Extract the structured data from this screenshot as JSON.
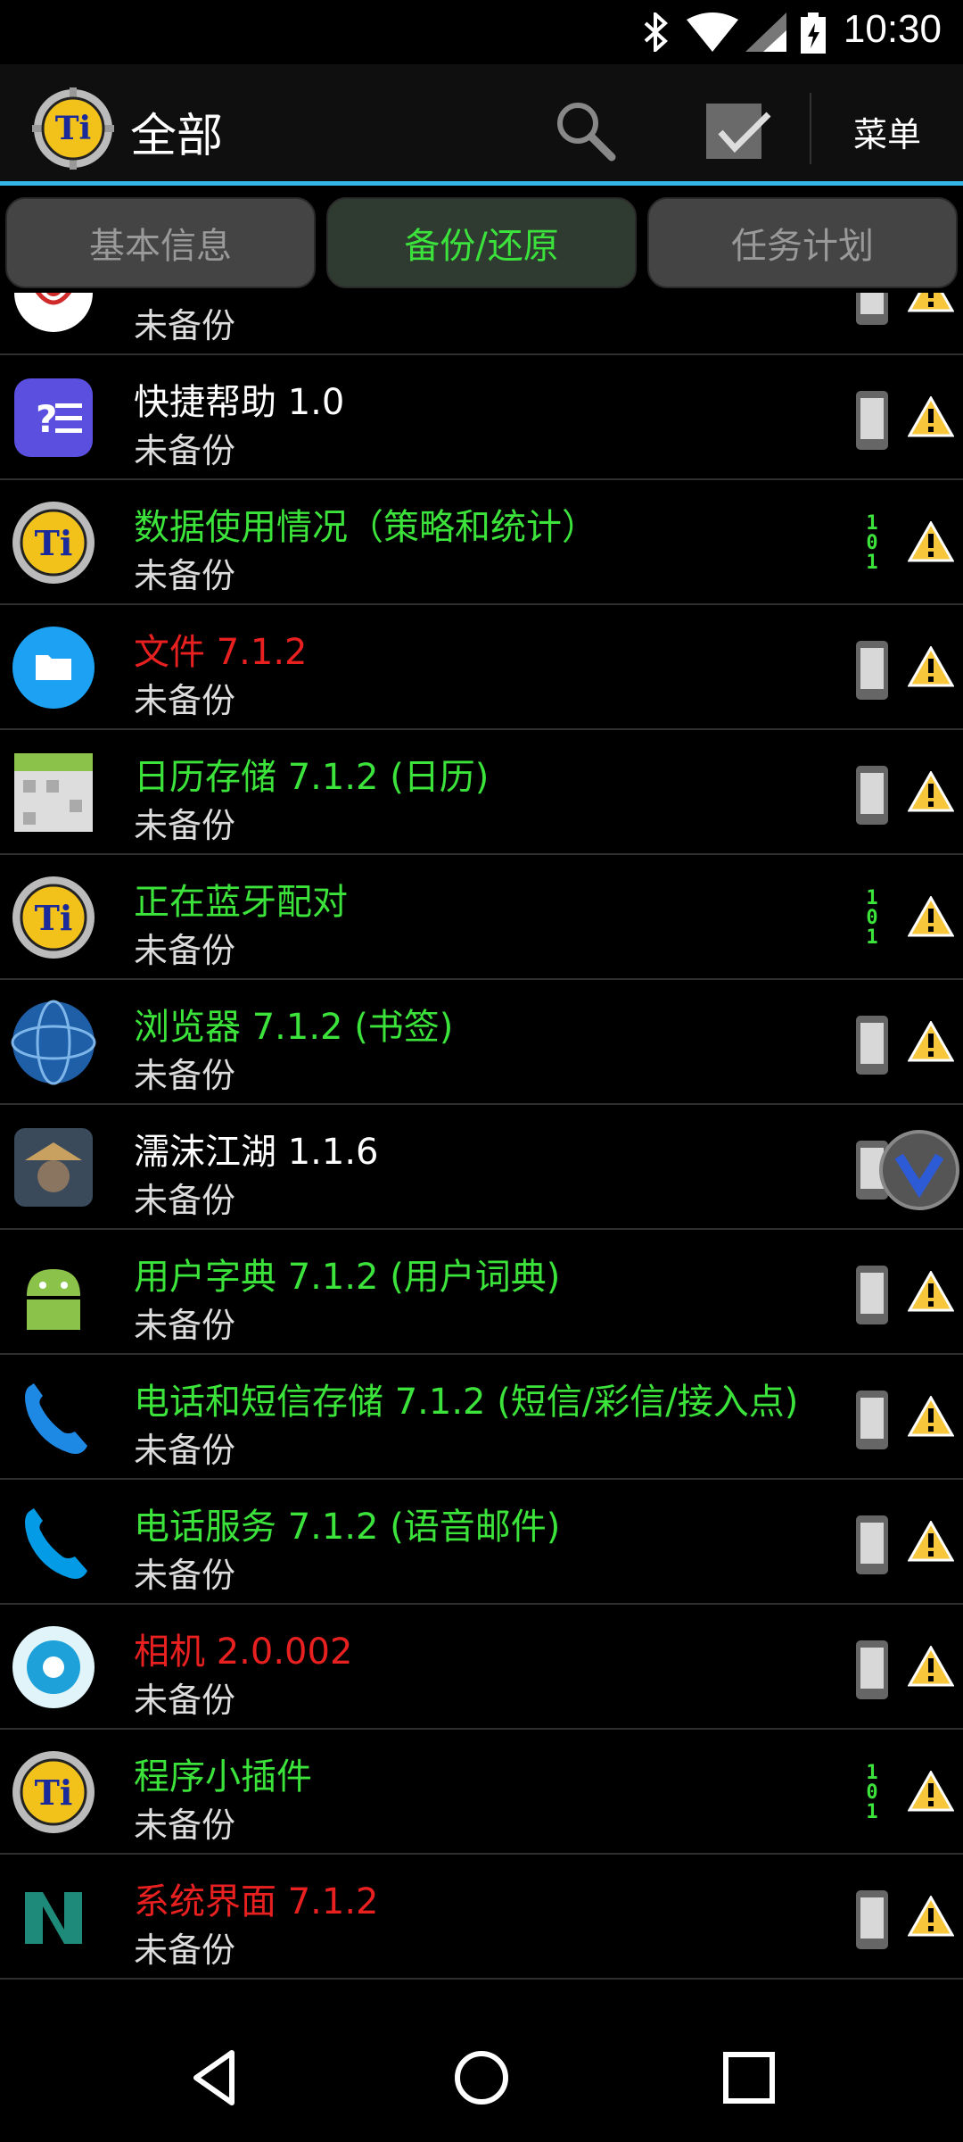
{
  "statusbar": {
    "time": "10:30"
  },
  "header": {
    "title": "全部",
    "menu_label": "菜单"
  },
  "tabs": [
    {
      "label": "基本信息",
      "active": false
    },
    {
      "label": "备份/还原",
      "active": true
    },
    {
      "label": "任务计划",
      "active": false
    }
  ],
  "colors": {
    "green": "#3be33b",
    "red": "#e82020",
    "accent": "#33b5e5"
  },
  "apps": [
    {
      "name": "",
      "status": "未备份",
      "color": "red",
      "icon": "microphone-icon",
      "indicator": "phone"
    },
    {
      "name": "快捷帮助 1.0",
      "status": "未备份",
      "color": "white",
      "icon": "shortcut-help-icon",
      "indicator": "phone"
    },
    {
      "name": "数据使用情况（策略和统计）",
      "status": "未备份",
      "color": "green",
      "icon": "titanium-icon",
      "indicator": "binary"
    },
    {
      "name": "文件 7.1.2",
      "status": "未备份",
      "color": "red",
      "icon": "files-icon",
      "indicator": "phone"
    },
    {
      "name": "日历存储 7.1.2 (日历)",
      "status": "未备份",
      "color": "green",
      "icon": "calendar-storage-icon",
      "indicator": "phone"
    },
    {
      "name": "正在蓝牙配对",
      "status": "未备份",
      "color": "green",
      "icon": "titanium-icon",
      "indicator": "binary"
    },
    {
      "name": "浏览器 7.1.2 (书签)",
      "status": "未备份",
      "color": "green",
      "icon": "browser-globe-icon",
      "indicator": "phone"
    },
    {
      "name": "濡沫江湖 1.1.6",
      "status": "未备份",
      "color": "white",
      "icon": "game-icon",
      "indicator": "phone"
    },
    {
      "name": "用户字典 7.1.2 (用户词典)",
      "status": "未备份",
      "color": "green",
      "icon": "android-icon",
      "indicator": "phone"
    },
    {
      "name": "电话和短信存储 7.1.2 (短信/彩信/接入点)",
      "status": "未备份",
      "color": "green",
      "icon": "phone-storage-icon",
      "indicator": "phone"
    },
    {
      "name": "电话服务 7.1.2 (语音邮件)",
      "status": "未备份",
      "color": "green",
      "icon": "phone-service-icon",
      "indicator": "phone"
    },
    {
      "name": "相机 2.0.002",
      "status": "未备份",
      "color": "red",
      "icon": "camera-icon",
      "indicator": "phone"
    },
    {
      "name": "程序小插件",
      "status": "未备份",
      "color": "green",
      "icon": "titanium-icon",
      "indicator": "binary"
    },
    {
      "name": "系统界面 7.1.2",
      "status": "未备份",
      "color": "red",
      "icon": "system-ui-icon",
      "indicator": "phone"
    }
  ]
}
